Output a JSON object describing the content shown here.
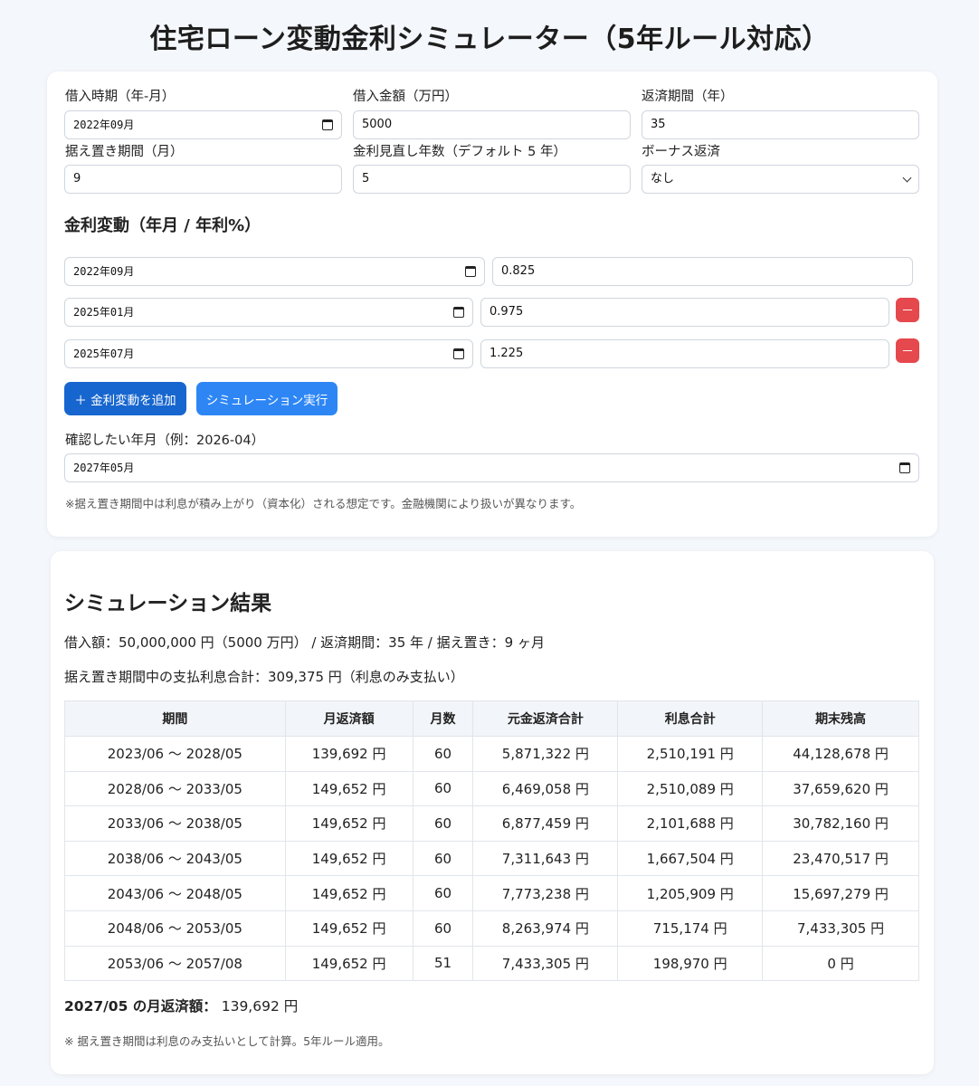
{
  "title": "住宅ローン変動金利シミュレーター（5年ルール対応）",
  "form": {
    "borrow_date_label": "借入時期（年-月）",
    "borrow_date_value": "2022年09月",
    "amount_label": "借入金額（万円）",
    "amount_value": "5000",
    "term_label": "返済期間（年）",
    "term_value": "35",
    "grace_label": "据え置き期間（月）",
    "grace_value": "9",
    "review_label": "金利見直し年数（デフォルト 5 年）",
    "review_value": "5",
    "bonus_label": "ボーナス返済",
    "bonus_value": "なし",
    "rates_heading": "金利変動（年月 / 年利%）",
    "rates": [
      {
        "date": "2022年09月",
        "rate": "0.825"
      },
      {
        "date": "2025年01月",
        "rate": "0.975"
      },
      {
        "date": "2025年07月",
        "rate": "1.225"
      }
    ],
    "remove_label": "－",
    "add_rate_button": "＋ 金利変動を追加",
    "run_button": "シミュレーション実行",
    "check_label": "確認したい年月（例：2026-04）",
    "check_value": "2027年05月",
    "note": "※据え置き期間中は利息が積み上がり（資本化）される想定です。金融機関により扱いが異なります。"
  },
  "result": {
    "title": "シミュレーション結果",
    "summary": "借入額：50,000,000 円（5000 万円） / 返済期間：35 年 / 据え置き：9 ヶ月",
    "grace_interest": "据え置き期間中の支払利息合計：309,375 円（利息のみ支払い）",
    "headers": [
      "期間",
      "月返済額",
      "月数",
      "元金返済合計",
      "利息合計",
      "期末残高"
    ],
    "rows": [
      [
        "2023/06 〜 2028/05",
        "139,692 円",
        "60",
        "5,871,322 円",
        "2,510,191 円",
        "44,128,678 円"
      ],
      [
        "2028/06 〜 2033/05",
        "149,652 円",
        "60",
        "6,469,058 円",
        "2,510,089 円",
        "37,659,620 円"
      ],
      [
        "2033/06 〜 2038/05",
        "149,652 円",
        "60",
        "6,877,459 円",
        "2,101,688 円",
        "30,782,160 円"
      ],
      [
        "2038/06 〜 2043/05",
        "149,652 円",
        "60",
        "7,311,643 円",
        "1,667,504 円",
        "23,470,517 円"
      ],
      [
        "2043/06 〜 2048/05",
        "149,652 円",
        "60",
        "7,773,238 円",
        "1,205,909 円",
        "15,697,279 円"
      ],
      [
        "2048/06 〜 2053/05",
        "149,652 円",
        "60",
        "8,263,974 円",
        "715,174 円",
        "7,433,305 円"
      ],
      [
        "2053/06 〜 2057/08",
        "149,652 円",
        "51",
        "7,433,305 円",
        "198,970 円",
        "0 円"
      ]
    ],
    "monthly_label": "2027/05 の月返済額：",
    "monthly_value": "139,692 円",
    "footnote": "※ 据え置き期間は利息のみ支払いとして計算。5年ルール適用。"
  }
}
